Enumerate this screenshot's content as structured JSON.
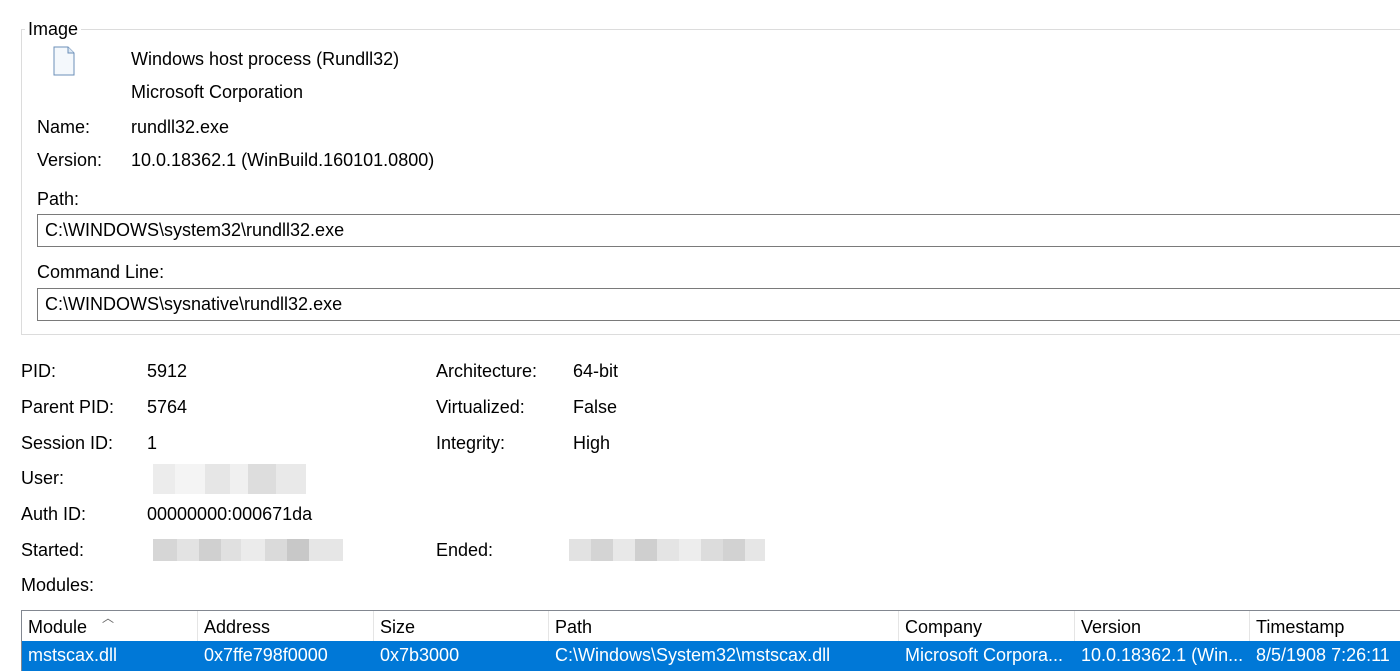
{
  "image_group": {
    "legend": "Image",
    "icon": "file-icon",
    "description": "Windows host process (Rundll32)",
    "company": "Microsoft Corporation",
    "name_label": "Name:",
    "name_value": "rundll32.exe",
    "version_label": "Version:",
    "version_value": "10.0.18362.1 (WinBuild.160101.0800)",
    "path_label": "Path:",
    "path_value": "C:\\WINDOWS\\system32\\rundll32.exe",
    "cmdline_label": "Command Line:",
    "cmdline_value": "C:\\WINDOWS\\sysnative\\rundll32.exe"
  },
  "process": {
    "pid_label": "PID:",
    "pid_value": "5912",
    "ppid_label": "Parent PID:",
    "ppid_value": "5764",
    "session_label": "Session ID:",
    "session_value": "1",
    "user_label": "User:",
    "authid_label": "Auth ID:",
    "authid_value": "00000000:000671da",
    "started_label": "Started:",
    "arch_label": "Architecture:",
    "arch_value": "64-bit",
    "virt_label": "Virtualized:",
    "virt_value": "False",
    "integrity_label": "Integrity:",
    "integrity_value": "High",
    "ended_label": "Ended:",
    "modules_label": "Modules:"
  },
  "modules_table": {
    "columns": [
      "Module",
      "Address",
      "Size",
      "Path",
      "Company",
      "Version",
      "Timestamp"
    ],
    "rows": [
      [
        "mstscax.dll",
        "0x7ffe798f0000",
        "0x7b3000",
        "C:\\Windows\\System32\\mstscax.dll",
        "Microsoft Corpora...",
        "10.0.18362.1 (Win...",
        "8/5/1908 7:26:11"
      ]
    ]
  },
  "colors": {
    "selection": "#0078d7",
    "border": "#7a7a7a"
  }
}
